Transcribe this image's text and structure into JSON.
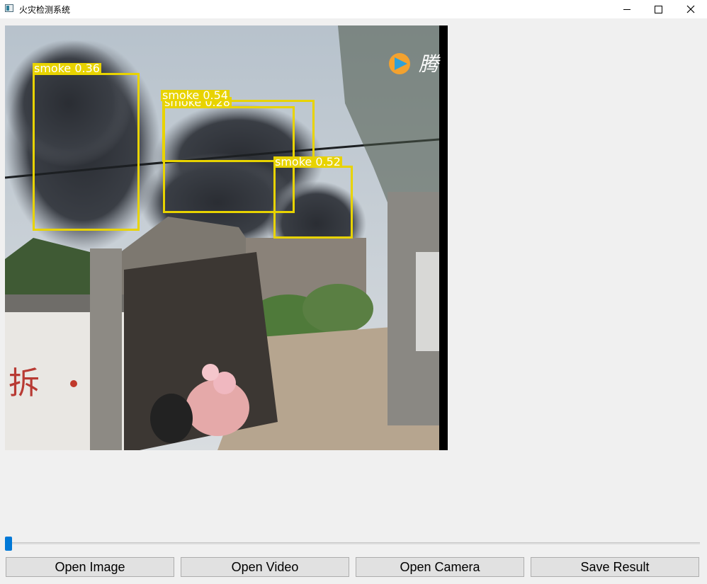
{
  "window": {
    "title": "火灾检测系统",
    "controls": {
      "minimize": "minimize-icon",
      "maximize": "maximize-icon",
      "close": "close-icon"
    }
  },
  "display": {
    "watermark": "腾",
    "detections": [
      {
        "label": "smoke 0.36"
      },
      {
        "label": "smoke 0.54"
      },
      {
        "label": "smoke 0.28"
      },
      {
        "label": "smoke 0.52"
      }
    ]
  },
  "slider": {
    "value": 0
  },
  "buttons": {
    "open_image": "Open Image",
    "open_video": "Open Video",
    "open_camera": "Open Camera",
    "save_result": "Save Result"
  },
  "colors": {
    "box": "#e8d300",
    "accent": "#0078d7"
  }
}
